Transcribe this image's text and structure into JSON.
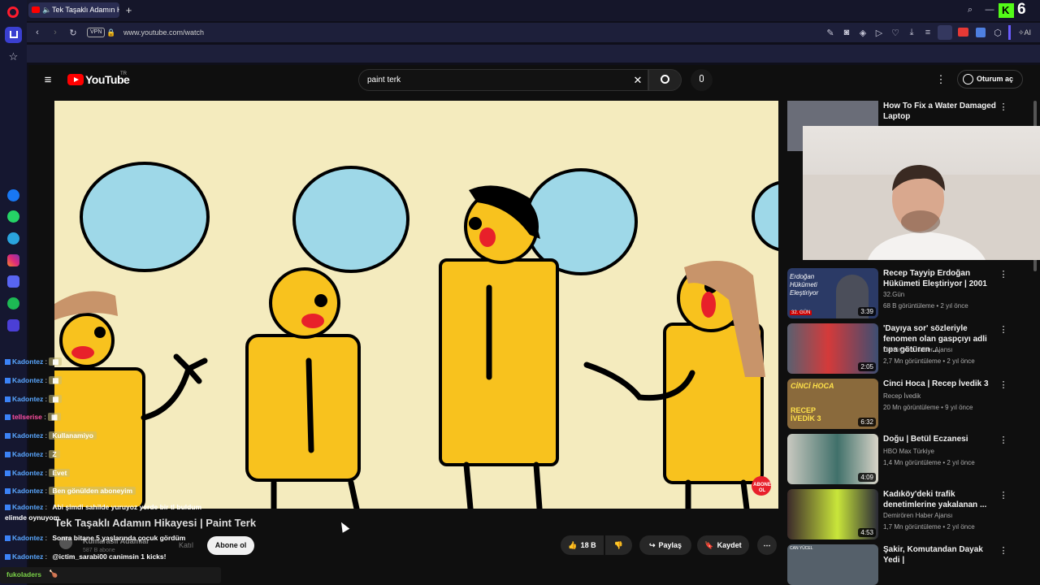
{
  "browser": {
    "tab_title": "Tek Taşaklı Adamın Hi",
    "url": "www.youtube.com/watch",
    "vpn": "VPN",
    "ai": "AI",
    "badge_count": "6"
  },
  "youtube": {
    "logo": "YouTube",
    "region": "TR",
    "search_value": "paint terk",
    "signin": "Oturum aç"
  },
  "video": {
    "title": "Tek Taşaklı Adamın Hikayesi | Paint Terk",
    "channel": "Kumarasıi Adamlar",
    "subs": "587 B abone",
    "join": "Katıl",
    "subscribe": "Abone ol",
    "likes": "18 B",
    "share": "Paylaş",
    "save": "Kaydet",
    "sticker": "ABONE OL"
  },
  "sidebar_videos": [
    {
      "title": "How To Fix a Water Damaged Laptop",
      "channel": "",
      "meta": "",
      "duration": ""
    },
    {
      "title": "Recep Tayyip Erdoğan Hükümeti Eleştiriyor | 2001",
      "channel": "32.Gün",
      "meta": "68 B görüntüleme • 2 yıl önce",
      "duration": "3:39",
      "thumb_text": "Erdoğan Hükümeti Eleştiriyor",
      "thumb_tag": "32. GÜN"
    },
    {
      "title": "'Dayıya sor' sözleriyle fenomen olan gaspçıyı adli tıpa götüren ...",
      "channel": "Demirören Haber Ajansı",
      "meta": "2,7 Mn görüntüleme • 2 yıl önce",
      "duration": "2:05"
    },
    {
      "title": "Cinci Hoca | Recep İvedik 3",
      "channel": "Recep İvedik",
      "meta": "20 Mn görüntüleme • 9 yıl önce",
      "duration": "6:32",
      "thumb_text": "CİNCİ HOCA",
      "thumb_text2": "RECEP İVEDİK 3"
    },
    {
      "title": "Doğu | Betül Eczanesi",
      "channel": "HBO Max Türkiye",
      "meta": "1,4 Mn görüntüleme • 2 yıl önce",
      "duration": "4:09"
    },
    {
      "title": "Kadıköy'deki trafik denetimlerine yakalanan ...",
      "channel": "Demirören Haber Ajansı",
      "meta": "1,7 Mn görüntüleme • 2 yıl önce",
      "duration": "4:53"
    },
    {
      "title": "Şakir, Komutandan Dayak Yedi |",
      "channel": "",
      "meta": "",
      "duration": "",
      "thumb_text": "CAN YÜCEL"
    }
  ],
  "chat": [
    {
      "user": "Kadontez",
      "msg": "",
      "emote": true
    },
    {
      "user": "Kadontez",
      "msg": "",
      "emote": true
    },
    {
      "user": "Kadontez",
      "msg": "",
      "emote": true
    },
    {
      "user": "tellserise",
      "msg": "",
      "emote": true
    },
    {
      "user": "Kadontez",
      "msg": "Kullanamiyo"
    },
    {
      "user": "Kadontez",
      "msg": "Z"
    },
    {
      "user": "Kadontez",
      "msg": "Evet"
    },
    {
      "user": "Kadontez",
      "msg": "Ben gönülden aboneyim"
    },
    {
      "user": "Kadontez",
      "msg": "Abi şimdi sahilde yuruyoz yerde bir tl buldum elimde oynuyom"
    },
    {
      "user": "Kadontez",
      "msg": "Sonra bitane 5 yaşlarında çocuk gördüm"
    },
    {
      "user": "Kadontez",
      "msg": "@ictim_sarabi00 canimsin 1 kicks!"
    }
  ],
  "chat_footer": {
    "user": "fukoladers",
    "msg": "🍗"
  }
}
